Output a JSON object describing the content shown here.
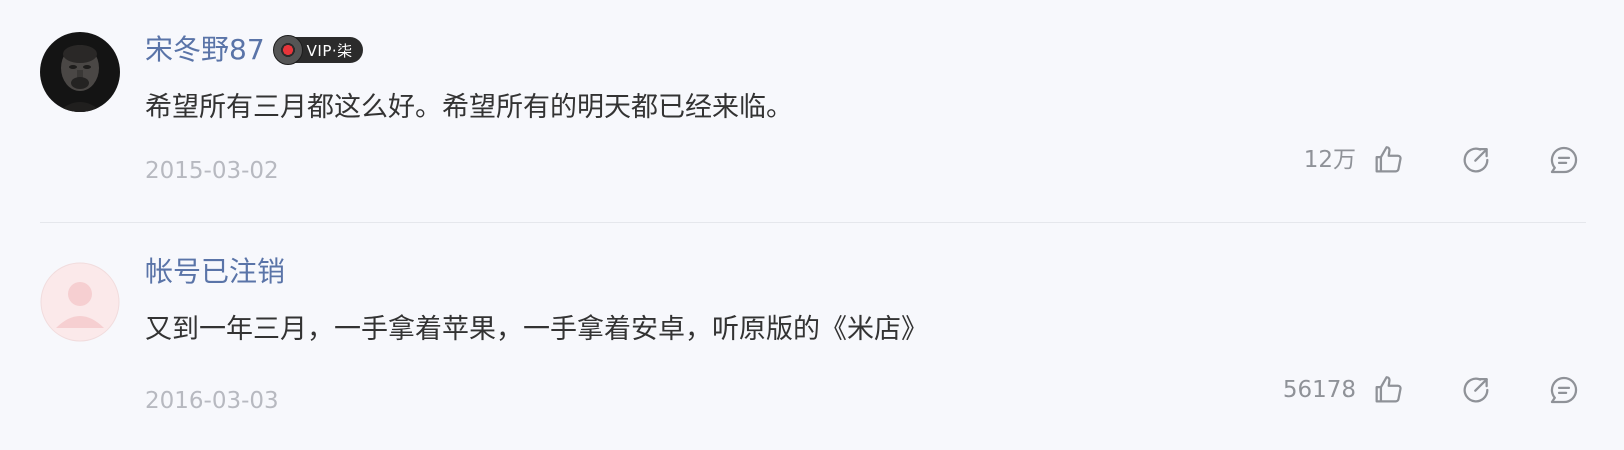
{
  "comments": [
    {
      "username": "宋冬野87",
      "vip_badge": "VIP·柒",
      "content": "希望所有三月都这么好。希望所有的明天都已经来临。",
      "date": "2015-03-02",
      "like_count": "12万"
    },
    {
      "username": "帐号已注销",
      "content": "又到一年三月，一手拿着苹果，一手拿着安卓，听原版的《米店》",
      "date": "2016-03-03",
      "like_count": "56178"
    }
  ],
  "icons": {
    "like": "thumbs-up-icon",
    "share": "share-icon",
    "reply": "comment-icon"
  },
  "colors": {
    "username": "#5a74a8",
    "text": "#333333",
    "meta": "#b7b9c0",
    "icon": "#8f9298",
    "background": "#f7f8fc"
  }
}
